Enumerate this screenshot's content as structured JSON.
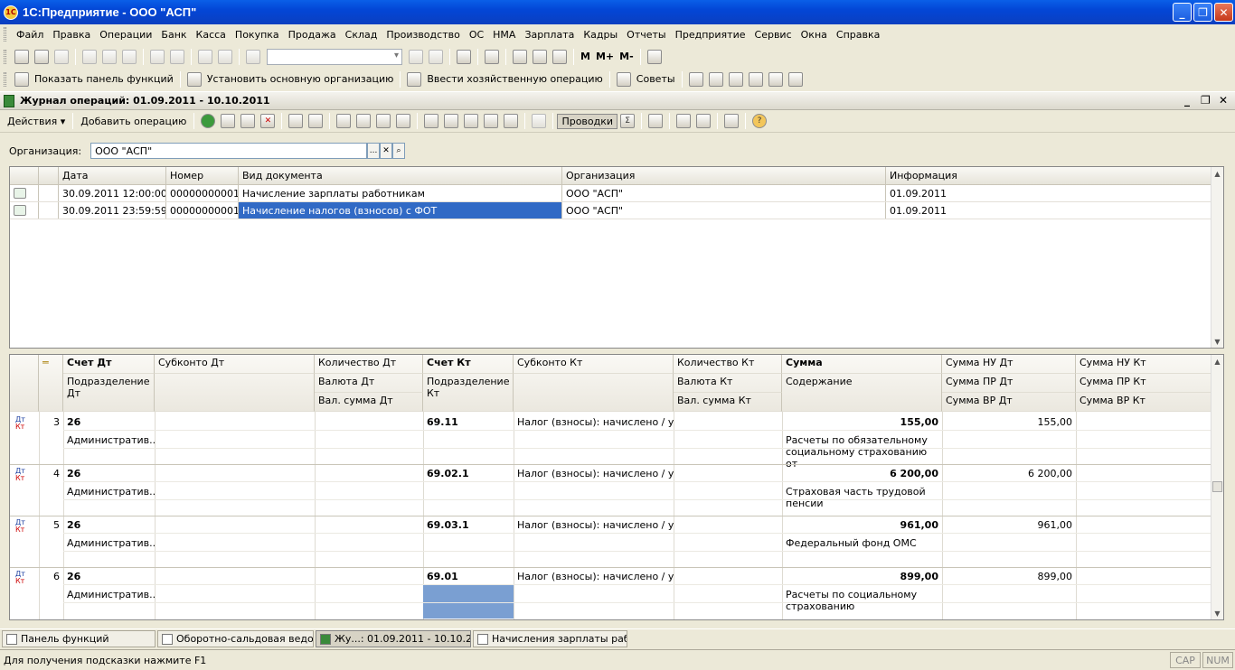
{
  "window": {
    "title": "1С:Предприятие - ООО \"АСП\"",
    "icon_text": "1C"
  },
  "menu": [
    "Файл",
    "Правка",
    "Операции",
    "Банк",
    "Касса",
    "Покупка",
    "Продажа",
    "Склад",
    "Производство",
    "ОС",
    "НМА",
    "Зарплата",
    "Кадры",
    "Отчеты",
    "Предприятие",
    "Сервис",
    "Окна",
    "Справка"
  ],
  "toolbar2": {
    "btn_panel": "Показать панель функций",
    "btn_org": "Установить основную организацию",
    "btn_op": "Ввести хозяйственную операцию",
    "btn_tips": "Советы",
    "m": "M",
    "mplus": "M+",
    "mminus": "M-"
  },
  "doc": {
    "title": "Журнал операций: 01.09.2011 - 10.10.2011"
  },
  "actions": {
    "actions_label": "Действия",
    "add_label": "Добавить операцию",
    "postings_label": "Проводки"
  },
  "org": {
    "label": "Организация:",
    "value": "ООО \"АСП\"",
    "btn": "..."
  },
  "journal": {
    "columns": [
      "Дата",
      "Номер",
      "Вид документа",
      "Организация",
      "Информация"
    ],
    "rows": [
      {
        "date": "30.09.2011 12:00:00",
        "number": "00000000001",
        "type": "Начисление зарплаты работникам",
        "org": "ООО \"АСП\"",
        "info": "01.09.2011"
      },
      {
        "date": "30.09.2011 23:59:59",
        "number": "00000000001",
        "type": "Начисление налогов (взносов) с ФОТ",
        "org": "ООО \"АСП\"",
        "info": "01.09.2011"
      }
    ]
  },
  "postings": {
    "headers": {
      "acc_dt": "Счет Дт",
      "sub_dt": "Субконто Дт",
      "qty_dt": "Количество Дт",
      "acc_kt": "Счет Кт",
      "sub_kt": "Субконто Кт",
      "qty_kt": "Количество Кт",
      "sum": "Сумма",
      "nu_dt": "Сумма НУ Дт",
      "nu_kt": "Сумма НУ Кт",
      "dept_dt": "Подразделение Дт",
      "cur_dt": "Валюта Дт",
      "dept_kt": "Подразделение Кт",
      "cur_kt": "Валюта Кт",
      "content": "Содержание",
      "pr_dt": "Сумма ПР Дт",
      "pr_kt": "Сумма ПР Кт",
      "valsum_dt": "Вал. сумма Дт",
      "valsum_kt": "Вал. сумма Кт",
      "vr_dt": "Сумма ВР Дт",
      "vr_kt": "Сумма ВР Кт"
    },
    "rows": [
      {
        "n": "3",
        "acc_dt": "26",
        "dept_dt": "Административ...",
        "acc_kt": "69.11",
        "sub_kt": "Налог (взносы): начислено / уп...",
        "sum": "155,00",
        "content": "Расчеты по обязательному социальному страхованию от",
        "nu_dt": "155,00"
      },
      {
        "n": "4",
        "acc_dt": "26",
        "dept_dt": "Административ...",
        "acc_kt": "69.02.1",
        "sub_kt": "Налог (взносы): начислено / уп...",
        "sum": "6 200,00",
        "content": "Страховая часть трудовой пенсии",
        "nu_dt": "6 200,00"
      },
      {
        "n": "5",
        "acc_dt": "26",
        "dept_dt": "Административ...",
        "acc_kt": "69.03.1",
        "sub_kt": "Налог (взносы): начислено / уп...",
        "sum": "961,00",
        "content": "Федеральный фонд ОМС",
        "nu_dt": "961,00"
      },
      {
        "n": "6",
        "acc_dt": "26",
        "dept_dt": "Административ...",
        "acc_kt": "69.01",
        "sub_kt": "Налог (взносы): начислено / уп...",
        "sum": "899,00",
        "content": "Расчеты по социальному страхованию",
        "nu_dt": "899,00"
      }
    ],
    "dtkt_dt": "Дт",
    "dtkt_kt": "Кт"
  },
  "taskbar": [
    "Панель функций",
    "Оборотно-сальдовая ведом...",
    "Жу...: 01.09.2011 - 10.10.2011",
    "Начисления зарплаты рабо..."
  ],
  "status": {
    "hint": "Для получения подсказки нажмите F1",
    "cap": "CAP",
    "num": "NUM"
  },
  "colors": {
    "title_bar": "#0346d6",
    "selection": "#316ac5",
    "chrome": "#ece9d8"
  }
}
